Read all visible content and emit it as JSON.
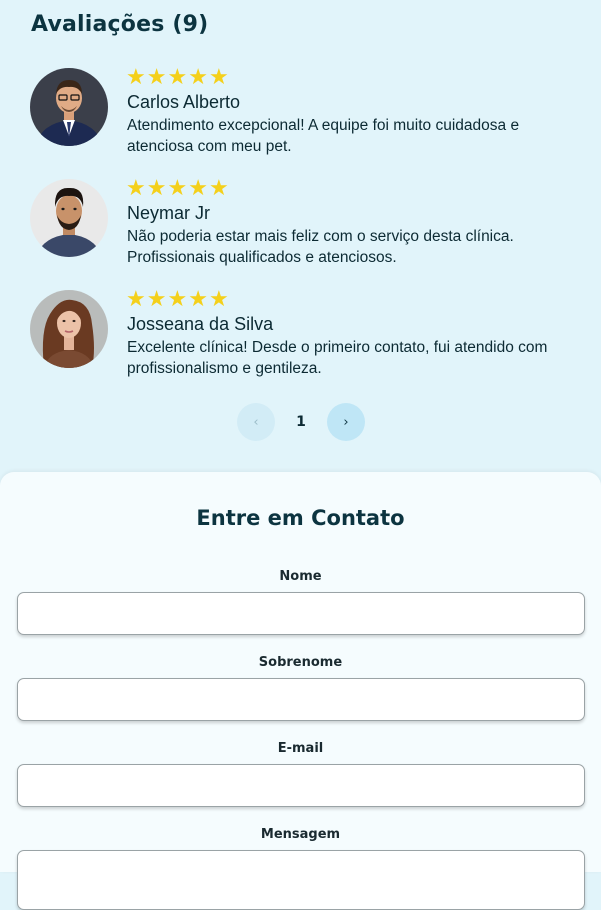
{
  "reviews": {
    "title": "Avaliações (9)",
    "items": [
      {
        "stars": "★★★★★",
        "name": "Carlos Alberto",
        "text": "Atendimento excepcional! A equipe foi muito cuidadosa e atenciosa com meu pet."
      },
      {
        "stars": "★★★★★",
        "name": "Neymar Jr",
        "text": "Não poderia estar mais feliz com o serviço desta clínica. Profissionais qualificados e atenciosos."
      },
      {
        "stars": "★★★★★",
        "name": "Josseana da Silva",
        "text": "Excelente clínica! Desde o primeiro contato, fui atendido com profissionalismo e gentileza."
      }
    ],
    "pagination": {
      "prev_icon": "‹",
      "current_page": "1",
      "next_icon": "›"
    }
  },
  "contact": {
    "title": "Entre em Contato",
    "fields": [
      {
        "label": "Nome",
        "value": ""
      },
      {
        "label": "Sobrenome",
        "value": ""
      },
      {
        "label": "E-mail",
        "value": ""
      },
      {
        "label": "Mensagem",
        "value": ""
      }
    ]
  },
  "colors": {
    "background": "#e1f4fa",
    "contact_background": "#f5fcfe",
    "heading": "#0c3440",
    "star": "#f4d01b"
  }
}
